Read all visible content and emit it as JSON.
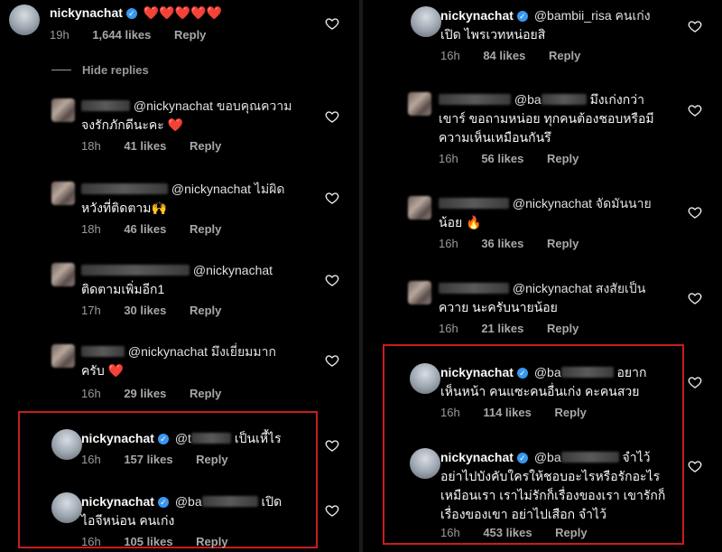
{
  "left": {
    "top_comment": {
      "username": "nickynachat",
      "text": "❤️❤️❤️❤️❤️",
      "time": "19h",
      "likes": "1,644 likes",
      "reply": "Reply"
    },
    "hide_replies": "Hide replies",
    "replies": [
      {
        "mention": "@nickynachat ขอบคุณความ",
        "line2": "จงรักภักดีนะคะ ❤️",
        "time": "18h",
        "likes": "41 likes",
        "reply": "Reply"
      },
      {
        "mention": "@nickynachat ไม่ผิด",
        "line2": "หวังที่ติดตาม🙌",
        "time": "18h",
        "likes": "46 likes",
        "reply": "Reply"
      },
      {
        "mention": "@nickynachat",
        "line2": "ติดตามเพิ่มอีก1",
        "time": "17h",
        "likes": "30 likes",
        "reply": "Reply"
      },
      {
        "mention": "@nickynachat มึงเยี่ยมมาก",
        "line2": "ครับ ❤️",
        "time": "16h",
        "likes": "29 likes",
        "reply": "Reply"
      },
      {
        "username": "nickynachat",
        "line1_pre": "@t",
        "line1_post": " เป็นเหี้ไร",
        "time": "16h",
        "likes": "157 likes",
        "reply": "Reply"
      },
      {
        "username": "nickynachat",
        "line1_pre": "@ba",
        "line1_post": " เปิด",
        "line2": "ไอจีหน่อน คนเก่ง",
        "time": "16h",
        "likes": "105 likes",
        "reply": "Reply"
      }
    ]
  },
  "right": {
    "replies": [
      {
        "username": "nickynachat",
        "line1": "@bambii_risa คนเก่ง",
        "line2": "เปิด ไพรเวทหน่อยสิ",
        "time": "16h",
        "likes": "84 likes",
        "reply": "Reply"
      },
      {
        "mention_pre": "@ba",
        "line1_post": " มึงเก่งกว่า",
        "line2": "เขาร์ ขอถามหน่อย ทุกคนต้องชอบหรือมี",
        "line3": "ความเห็นเหมือนกันรึ",
        "time": "16h",
        "likes": "56 likes",
        "reply": "Reply"
      },
      {
        "mention": "@nickynachat จัดมันนาย",
        "line2": "น้อย 🔥",
        "time": "16h",
        "likes": "36 likes",
        "reply": "Reply"
      },
      {
        "mention": "@nickynachat สงสัยเป็น",
        "line2": "ควาย นะครับนายน้อย",
        "time": "16h",
        "likes": "21 likes",
        "reply": "Reply"
      },
      {
        "username": "nickynachat",
        "line1_pre": "@ba",
        "line1_post": " อยาก",
        "line2": "เห็นหน้า คนแซะคนอื่นเก่ง คะคนสวย",
        "time": "16h",
        "likes": "114 likes",
        "reply": "Reply"
      },
      {
        "username": "nickynachat",
        "line1_pre": "@ba",
        "line1_post": " จำไว้",
        "line2": "อย่าไปบังคับใครให้ชอบอะไรหรือรักอะไร",
        "line3": "เหมือนเรา เราไม่รักก็เรื่องของเรา เขารักก็",
        "line4": "เรื่องของเขา อย่าไปเสือก จำไว้",
        "time": "16h",
        "likes": "453 likes",
        "reply": "Reply"
      }
    ]
  },
  "colors": {
    "highlight_box": "#c81d1d",
    "verified": "#3897f0"
  }
}
